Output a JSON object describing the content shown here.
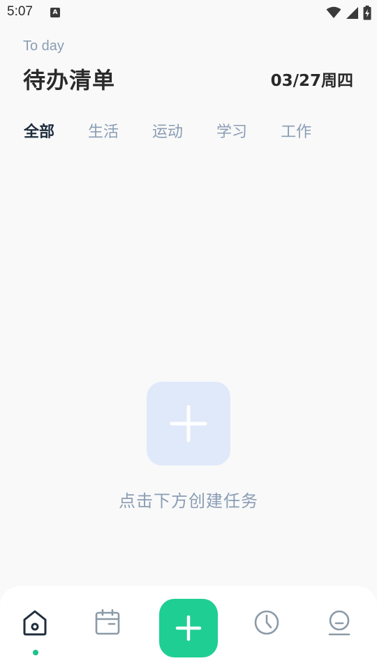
{
  "status_bar": {
    "time": "5:07",
    "app_icon_letter": "A",
    "icons": [
      "wifi-icon",
      "cellular-signal-icon",
      "battery-charging-icon"
    ]
  },
  "header": {
    "subtitle": "To day",
    "title": "待办清单",
    "date": "03/27周四"
  },
  "tabs": [
    {
      "label": "全部",
      "active": true
    },
    {
      "label": "生活",
      "active": false
    },
    {
      "label": "运动",
      "active": false
    },
    {
      "label": "学习",
      "active": false
    },
    {
      "label": "工作",
      "active": false
    }
  ],
  "empty_state": {
    "icon": "plus-icon",
    "text": "点击下方创建任务"
  },
  "bottom_nav": {
    "items": [
      {
        "icon": "home-icon",
        "active": true
      },
      {
        "icon": "calendar-icon",
        "active": false
      },
      {
        "icon": "plus-icon",
        "active": false
      },
      {
        "icon": "clock-icon",
        "active": false
      },
      {
        "icon": "profile-icon",
        "active": false
      }
    ]
  },
  "colors": {
    "accent": "#1fce92",
    "active_dot": "#1ec28b",
    "muted_text": "#8a9db4",
    "icon_gray": "#8b9aa8",
    "empty_tile": "#e0e9fa",
    "background": "#f9f9f9"
  }
}
